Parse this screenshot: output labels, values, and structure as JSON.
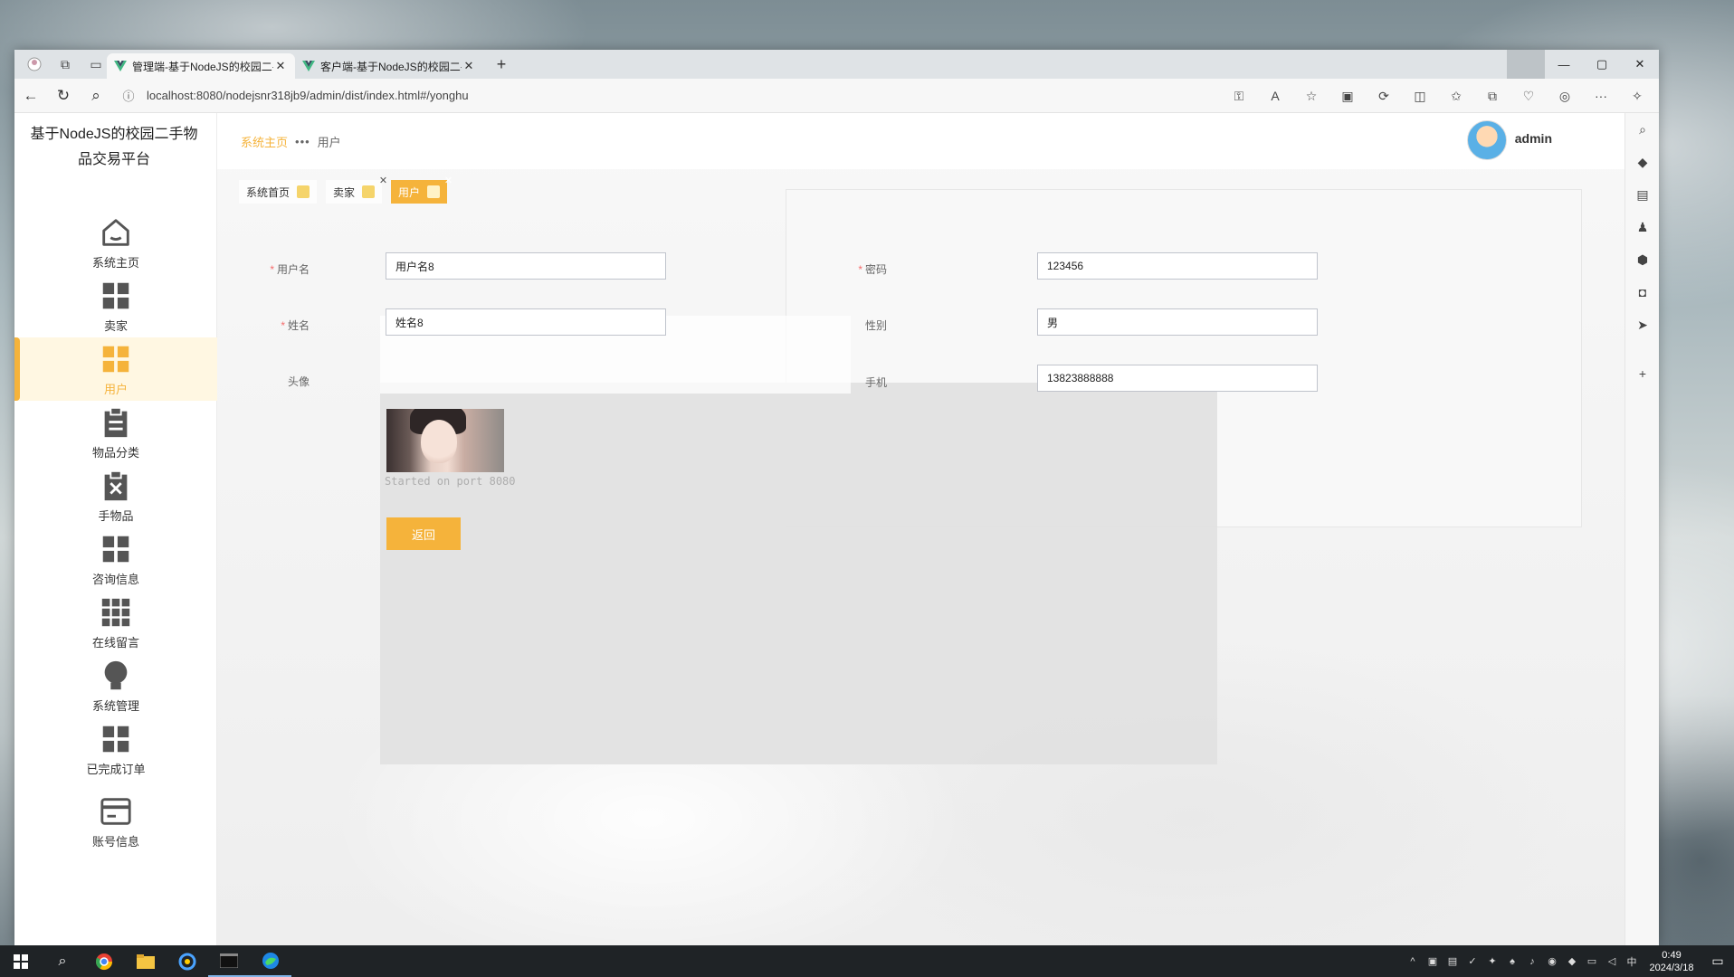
{
  "browser": {
    "tabs": [
      {
        "title": "管理端-基于NodeJS的校园二手物",
        "active": true
      },
      {
        "title": "客户端-基于NodeJS的校园二手物",
        "active": false
      }
    ],
    "url": "localhost:8080/nodejsnr318jb9/admin/dist/index.html#/yonghu"
  },
  "sidebar": {
    "brand": "基于NodeJS的校园二手物品交易平台",
    "items": [
      {
        "label": "系统主页",
        "icon": "home-icon"
      },
      {
        "label": "卖家",
        "icon": "grid-icon"
      },
      {
        "label": "用户",
        "icon": "grid-icon",
        "active": true
      },
      {
        "label": "物品分类",
        "icon": "clipboard-icon"
      },
      {
        "label": "手物品",
        "icon": "clipboard-x-icon"
      },
      {
        "label": "咨询信息",
        "icon": "grid-icon"
      },
      {
        "label": "在线留言",
        "icon": "grid-nine-icon"
      },
      {
        "label": "系统管理",
        "icon": "bulb-icon"
      },
      {
        "label": "已完成订单",
        "icon": "grid-icon"
      },
      {
        "label": "账号信息",
        "icon": "card-icon"
      }
    ]
  },
  "header": {
    "breadcrumb_home": "系统主页",
    "breadcrumb_sep": "•••",
    "breadcrumb_current": "用户",
    "username": "admin"
  },
  "tags": [
    {
      "label": "系统首页",
      "active": false
    },
    {
      "label": "卖家",
      "active": false
    },
    {
      "label": "用户",
      "active": true
    }
  ],
  "form": {
    "username_label": "用户名",
    "username_value": "用户名8",
    "password_label": "密码",
    "password_value": "123456",
    "name_label": "姓名",
    "name_value": "姓名8",
    "gender_label": "性别",
    "gender_value": "男",
    "avatar_label": "头像",
    "phone_label": "手机",
    "phone_value": "13823888888",
    "back_button": "返回"
  },
  "ghost_terminal": {
    "lines": [
      "Started on port 8080"
    ]
  },
  "taskbar": {
    "time": "0:49",
    "date": "2024/3/18",
    "ime": "中"
  },
  "colors": {
    "accent": "#f5b33b",
    "required": "#f56c6c"
  }
}
